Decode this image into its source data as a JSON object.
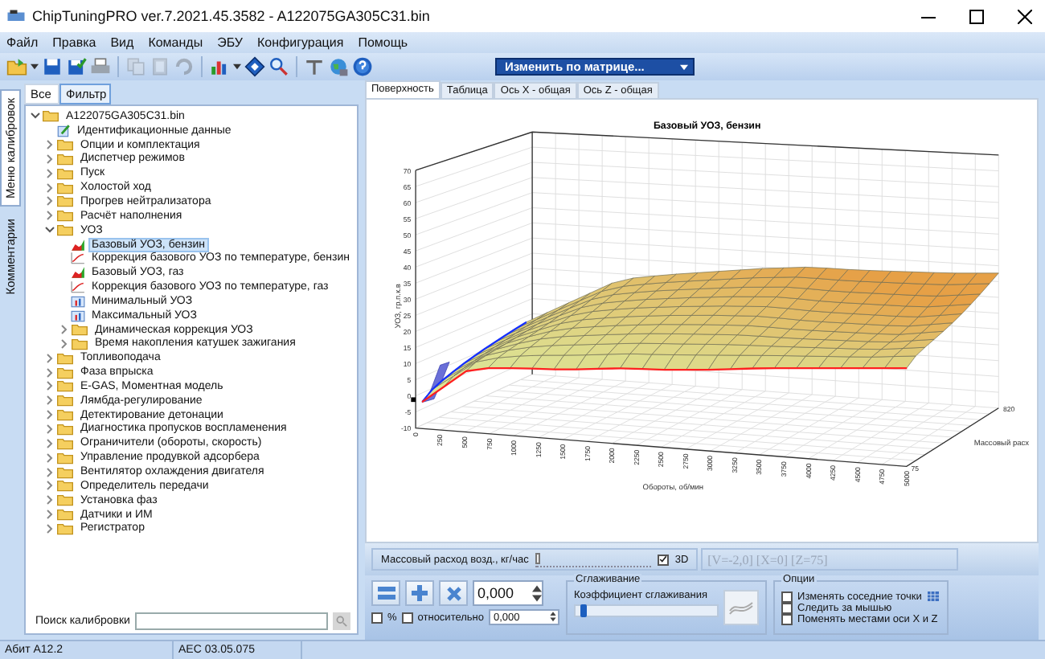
{
  "window": {
    "title": "ChipTuningPRO ver.7.2021.45.3582 - A122075GA305C31.bin"
  },
  "menu": [
    "Файл",
    "Правка",
    "Вид",
    "Команды",
    "ЭБУ",
    "Конфигурация",
    "Помощь"
  ],
  "toolbar": {
    "buttons": [
      {
        "disabled": false
      },
      {
        "disabled": false
      },
      {
        "disabled": false
      },
      {
        "disabled": false
      },
      {
        "disabled": true
      },
      {
        "disabled": true
      },
      {
        "disabled": true
      },
      {
        "disabled": false
      },
      {
        "disabled": false
      },
      {
        "disabled": false
      },
      {
        "disabled": false
      },
      {
        "disabled": false
      },
      {
        "disabled": false
      }
    ],
    "dropdown": "Изменить по матрице..."
  },
  "side_tabs": [
    {
      "label": "Меню калибровок",
      "selected": true
    },
    {
      "label": "Комментарии",
      "selected": false
    }
  ],
  "tree_tabs": [
    {
      "label": "Все",
      "selected": false
    },
    {
      "label": "Фильтр",
      "selected": true
    }
  ],
  "tree": [
    {
      "label": "A122075GA305C31.bin",
      "kind": "folder",
      "expanded": true,
      "selected": false,
      "children": [
        {
          "label": "Идентификационные данные",
          "kind": "document",
          "selected": false
        },
        {
          "label": "Опции и комплектация",
          "kind": "folder",
          "expanded": false,
          "selected": false
        },
        {
          "label": "Диспетчер режимов",
          "kind": "folder",
          "expanded": false,
          "selected": false
        },
        {
          "label": "Пуск",
          "kind": "folder",
          "expanded": false,
          "selected": false
        },
        {
          "label": "Холостой ход",
          "kind": "folder",
          "expanded": false,
          "selected": false
        },
        {
          "label": "Прогрев нейтрализатора",
          "kind": "folder",
          "expanded": false,
          "selected": false
        },
        {
          "label": "Расчёт наполнения",
          "kind": "folder",
          "expanded": false,
          "selected": false
        },
        {
          "label": "УОЗ",
          "kind": "folder",
          "expanded": true,
          "selected": false,
          "children": [
            {
              "label": "Базовый УОЗ, бензин",
              "kind": "map",
              "selected": true
            },
            {
              "label": "Коррекция базового УОЗ по температуре, бензин",
              "kind": "curve",
              "selected": false
            },
            {
              "label": "Базовый УОЗ, газ",
              "kind": "map",
              "selected": false
            },
            {
              "label": "Коррекция базового УОЗ по температуре, газ",
              "kind": "curve",
              "selected": false
            },
            {
              "label": "Минимальный УОЗ",
              "kind": "table",
              "selected": false
            },
            {
              "label": "Максимальный УОЗ",
              "kind": "table",
              "selected": false
            },
            {
              "label": "Динамическая коррекция УОЗ",
              "kind": "folder",
              "expanded": false,
              "selected": false
            },
            {
              "label": "Время накопления катушек зажигания",
              "kind": "folder",
              "expanded": false,
              "selected": false
            }
          ]
        },
        {
          "label": "Топливоподача",
          "kind": "folder",
          "expanded": false,
          "selected": false
        },
        {
          "label": "Фаза впрыска",
          "kind": "folder",
          "expanded": false,
          "selected": false
        },
        {
          "label": "E-GAS, Моментная модель",
          "kind": "folder",
          "expanded": false,
          "selected": false
        },
        {
          "label": "Лямбда-регулирование",
          "kind": "folder",
          "expanded": false,
          "selected": false
        },
        {
          "label": "Детектирование детонации",
          "kind": "folder",
          "expanded": false,
          "selected": false
        },
        {
          "label": "Диагностика пропусков воспламенения",
          "kind": "folder",
          "expanded": false,
          "selected": false
        },
        {
          "label": "Ограничители (обороты, скорость)",
          "kind": "folder",
          "expanded": false,
          "selected": false
        },
        {
          "label": "Управление продувкой адсорбера",
          "kind": "folder",
          "expanded": false,
          "selected": false
        },
        {
          "label": "Вентилятор охлаждения двигателя",
          "kind": "folder",
          "expanded": false,
          "selected": false
        },
        {
          "label": "Определитель передачи",
          "kind": "folder",
          "expanded": false,
          "selected": false
        },
        {
          "label": "Установка фаз",
          "kind": "folder",
          "expanded": false,
          "selected": false
        },
        {
          "label": "Датчики и ИМ",
          "kind": "folder",
          "expanded": false,
          "selected": false
        },
        {
          "label": "Регистратор",
          "kind": "folder",
          "expanded": false,
          "selected": false
        }
      ]
    }
  ],
  "search": {
    "label": "Поиск калибровки"
  },
  "view_tabs": [
    {
      "label": "Поверхность",
      "selected": true
    },
    {
      "label": "Таблица",
      "selected": false
    },
    {
      "label": "Ось X - общая",
      "selected": false
    },
    {
      "label": "Ось Z - общая",
      "selected": false
    }
  ],
  "chart": {
    "title": "Базовый УОЗ, бензин",
    "ylabel": "УОЗ, гр.п.к.в",
    "xlabel": "Обороты, об/мин",
    "zlabel": "Массовый расх",
    "yticks": [
      "70",
      "65",
      "60",
      "55",
      "50",
      "45",
      "40",
      "35",
      "30",
      "25",
      "20",
      "15",
      "10",
      "5",
      "0",
      "-5",
      "-10"
    ],
    "xticks": [
      "0",
      "250",
      "500",
      "750",
      "1000",
      "1250",
      "1500",
      "1750",
      "2000",
      "2250",
      "2500",
      "2750",
      "3000",
      "3250",
      "3500",
      "3750",
      "4000",
      "4250",
      "4500",
      "4750",
      "5000"
    ],
    "zticks": [
      "75",
      "820"
    ]
  },
  "slice": {
    "label": "Массовый расход возд., кг/час",
    "level": 0,
    "three_d": {
      "label": "3D",
      "checked": true
    },
    "readout": "[V=-2,0] [X=0] [Z=75]"
  },
  "edit": {
    "value": "0,000",
    "percent": {
      "label": "%",
      "checked": false
    },
    "relative": {
      "label": "относительно",
      "checked": false,
      "value": "0,000"
    }
  },
  "smoothing": {
    "title": "Сглаживание",
    "label": "Коэффициент сглаживания",
    "level": 0.03
  },
  "options": {
    "title": "Опции",
    "items": [
      {
        "label": "Изменять соседние точки",
        "checked": false
      },
      {
        "label": "Следить за мышью",
        "checked": false
      },
      {
        "label": "Поменять местами оси X и Z",
        "checked": false
      }
    ]
  },
  "status_bar": [
    "Абит A12.2",
    "AEC 03.05.075"
  ]
}
